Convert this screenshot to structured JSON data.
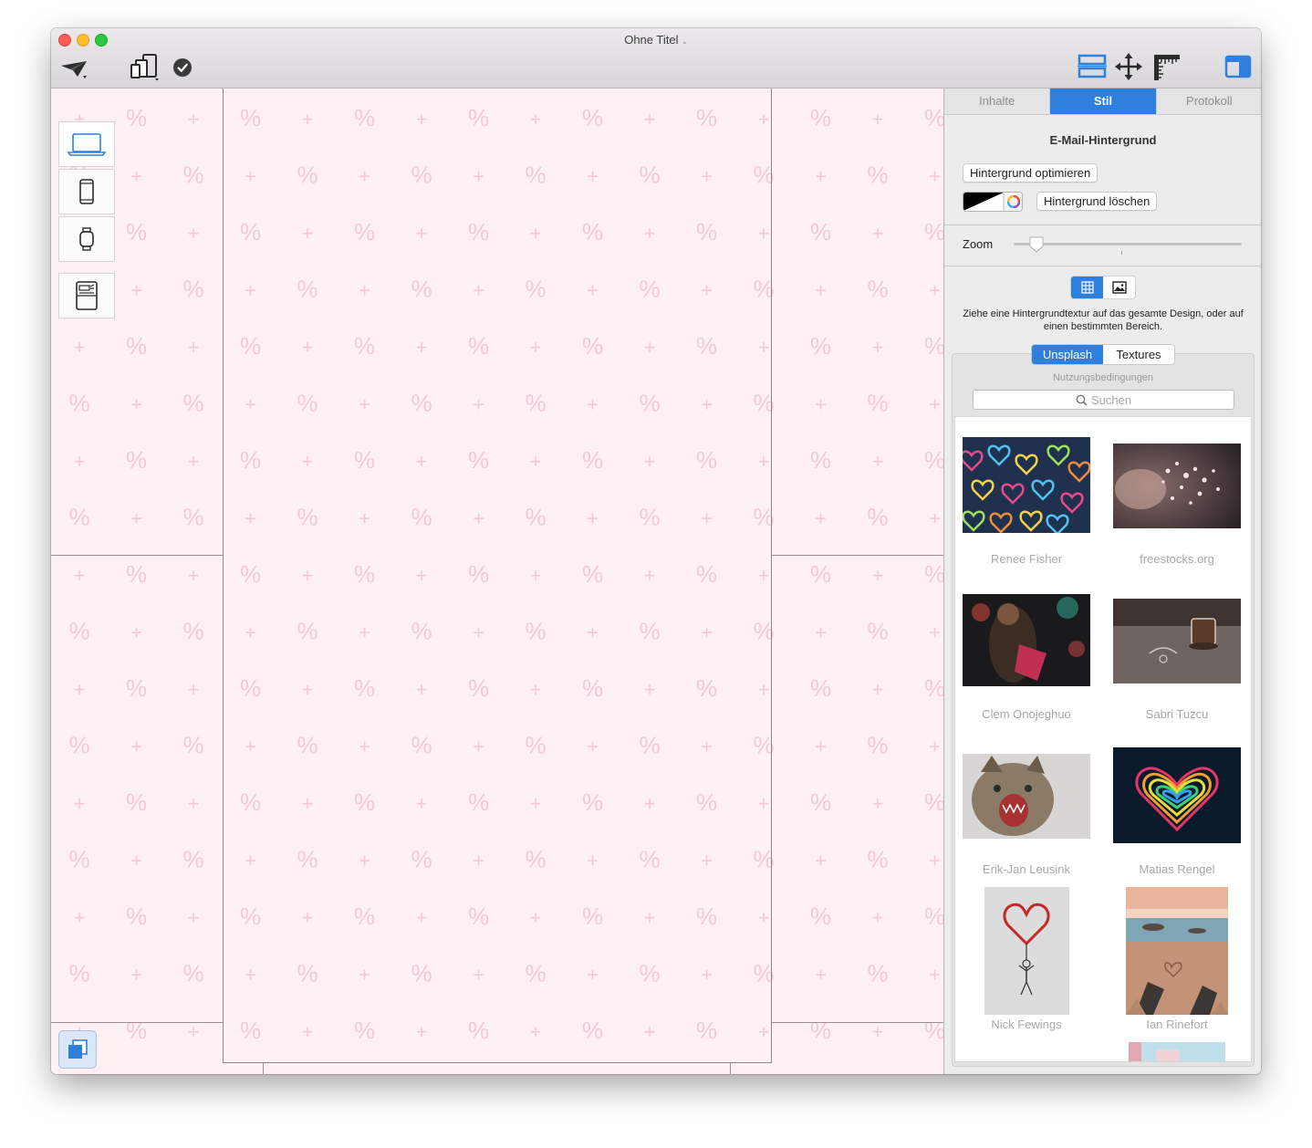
{
  "window": {
    "title": "Ohne Titel"
  },
  "toolbar": {
    "icons": [
      "send-icon",
      "devices-icon",
      "checkmark-icon",
      "layout-rows-icon",
      "move-icon",
      "ruler-icon",
      "sidebar-icon"
    ]
  },
  "canvas": {
    "background": "#fff0f4",
    "pattern_symbols": [
      "+",
      "%"
    ],
    "device_buttons": [
      "laptop-icon",
      "phone-icon",
      "watch-icon",
      "newsletter-icon"
    ]
  },
  "sidebar": {
    "tabs": [
      {
        "label": "Inhalte",
        "active": false
      },
      {
        "label": "Stil",
        "active": true
      },
      {
        "label": "Protokoll",
        "active": false
      }
    ],
    "section_title": "E-Mail-Hintergrund",
    "optimize_button": "Hintergrund optimieren",
    "delete_button": "Hintergrund löschen",
    "zoom_label": "Zoom",
    "zoom_value": 0.1,
    "hint": "Ziehe eine Hintergrundtextur auf das gesamte Design, oder auf einen bestimmten Bereich.",
    "source_tabs": [
      {
        "label": "Unsplash",
        "active": true
      },
      {
        "label": "Textures",
        "active": false
      }
    ],
    "terms_link": "Nutzungsbedingungen",
    "search_placeholder": "Suchen",
    "photos": [
      {
        "credit": "Renee Fisher"
      },
      {
        "credit": "freestocks.org"
      },
      {
        "credit": "Clem Onojeghuo"
      },
      {
        "credit": "Sabri Tuzcu"
      },
      {
        "credit": "Erik-Jan Leusink"
      },
      {
        "credit": "Matias Rengel"
      },
      {
        "credit": "Nick Fewings"
      },
      {
        "credit": "Ian Rinefort"
      }
    ]
  },
  "colors": {
    "accent": "#2f80dc",
    "canvas_bg": "#fff0f4"
  }
}
